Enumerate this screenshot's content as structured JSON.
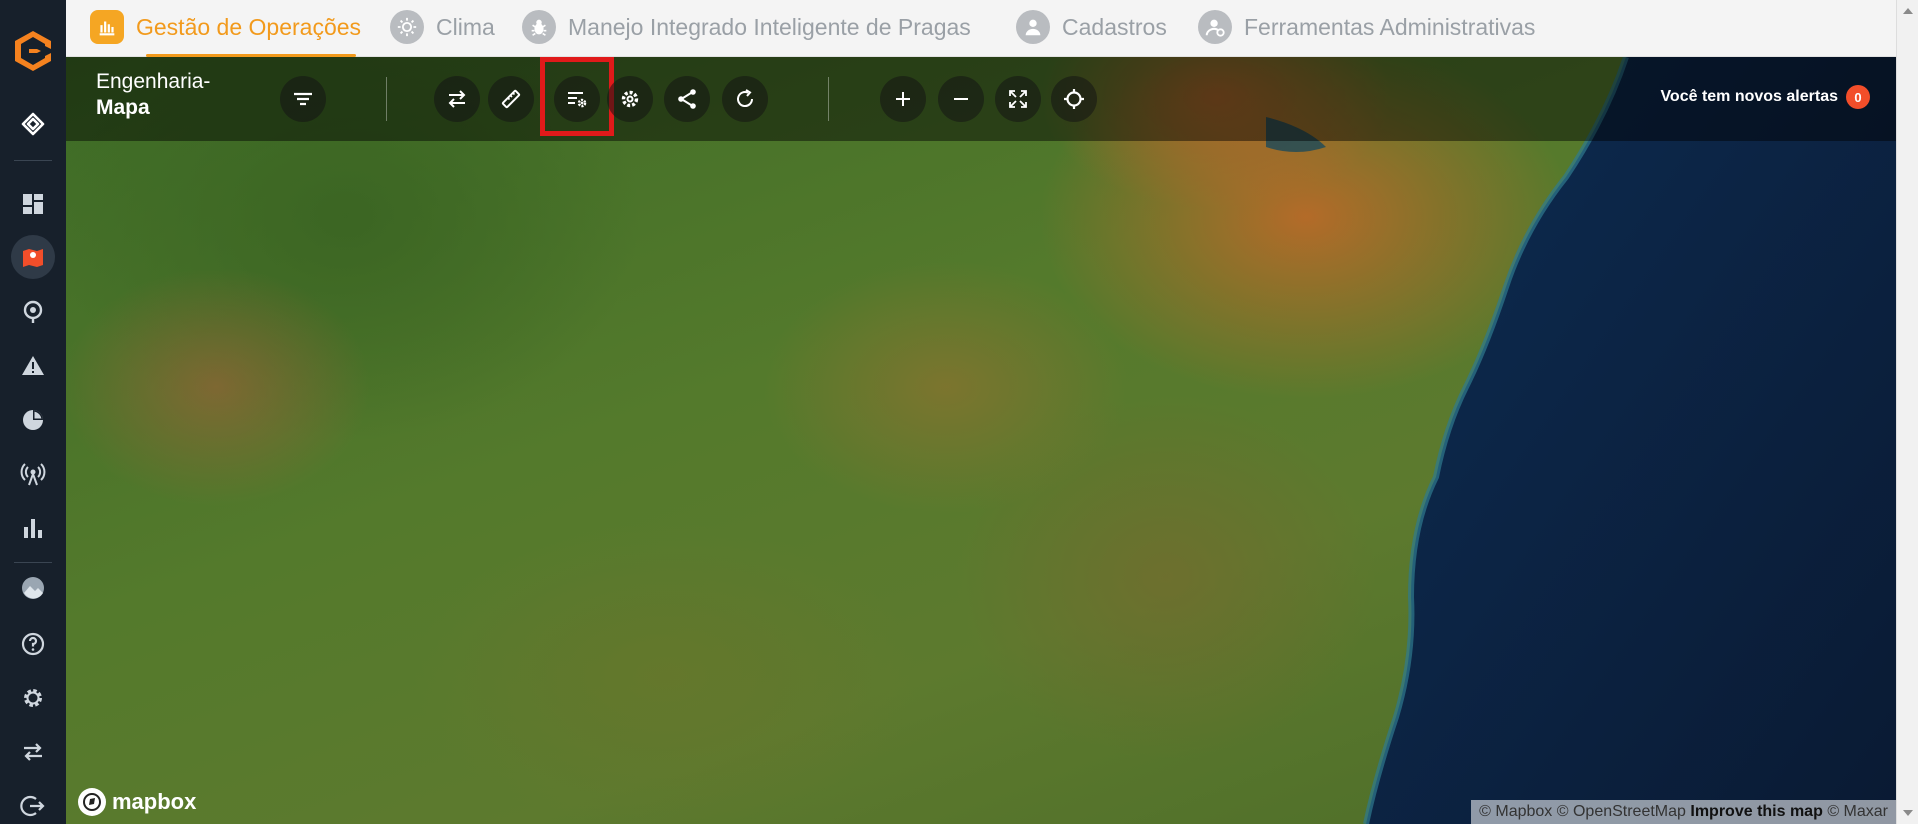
{
  "nav": {
    "tabs": [
      {
        "label": "Gestão de Operações",
        "icon": "operations-icon",
        "active": true
      },
      {
        "label": "Clima",
        "icon": "sun-icon"
      },
      {
        "label": "Manejo Integrado Inteligente de Pragas",
        "icon": "bug-icon"
      },
      {
        "label": "Cadastros",
        "icon": "user-icon"
      },
      {
        "label": "Ferramentas Administrativas",
        "icon": "admin-user-icon"
      }
    ]
  },
  "rail": {
    "items": [
      "logo-icon",
      "diamond-icon",
      "dashboard-icon",
      "map-pin-icon",
      "satellite-pin-icon",
      "warning-icon",
      "pie-chart-icon",
      "antenna-icon",
      "bar-chart-icon",
      "avatar",
      "help-icon",
      "settings-icon",
      "swap-icon",
      "logout-icon"
    ]
  },
  "map": {
    "title_line1": "Engenharia-",
    "title_line2": "Mapa",
    "tools": [
      "filter-icon",
      "swap-arrows-icon",
      "ruler-icon",
      "list-settings-icon",
      "gear-icon",
      "share-icon",
      "refresh-icon",
      "zoom-in-icon",
      "zoom-out-icon",
      "fullscreen-icon",
      "locate-icon"
    ],
    "alerts_text": "Você tem novos alertas",
    "alerts_count": "0",
    "logo_text": "mapbox",
    "attribution": {
      "mapbox": "© Mapbox",
      "osm": "© OpenStreetMap",
      "improve": "Improve this map",
      "maxar": "© Maxar"
    }
  },
  "colors": {
    "accent": "#f29a1c",
    "rail": "#17202b",
    "highlight": "#e01a1a",
    "badge": "#f24e2a"
  }
}
